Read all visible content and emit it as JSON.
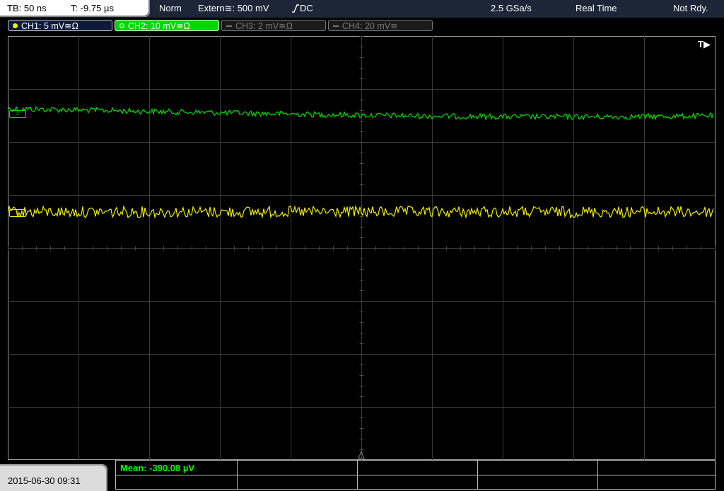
{
  "topbar": {
    "timebase": "TB: 50 ns",
    "trigger_time": "T: -9.75 µs",
    "trigger_mode": "Norm",
    "trigger_source": "Extern≅: 500 mV",
    "trigger_coupling": "DC",
    "sample_rate": "2.5 GSa/s",
    "acquisition_mode": "Real Time",
    "run_state": "Not Rdy."
  },
  "channels": [
    {
      "label": "CH1: 5 mV≅Ω",
      "color": "#f2f200",
      "active": true
    },
    {
      "label": "CH2: 10 mV≅Ω",
      "color": "#00ff00",
      "active": true,
      "selected": true
    },
    {
      "label": "CH3: 2 mV≅Ω",
      "color": "#777777",
      "active": false
    },
    {
      "label": "CH4: 20 mV≅",
      "color": "#777777",
      "active": false
    }
  ],
  "screen": {
    "trigger_marker": "T▶",
    "ch1_ground_marker": "1",
    "ch2_ground_marker": "2"
  },
  "footer": {
    "datetime": "2015-06-30 09:31",
    "measurement": "Mean: -390.08 µV"
  },
  "colors": {
    "ch1": "#f2f200",
    "ch2": "#00e000",
    "grid": "#3a3a3a",
    "background": "#000000"
  }
}
